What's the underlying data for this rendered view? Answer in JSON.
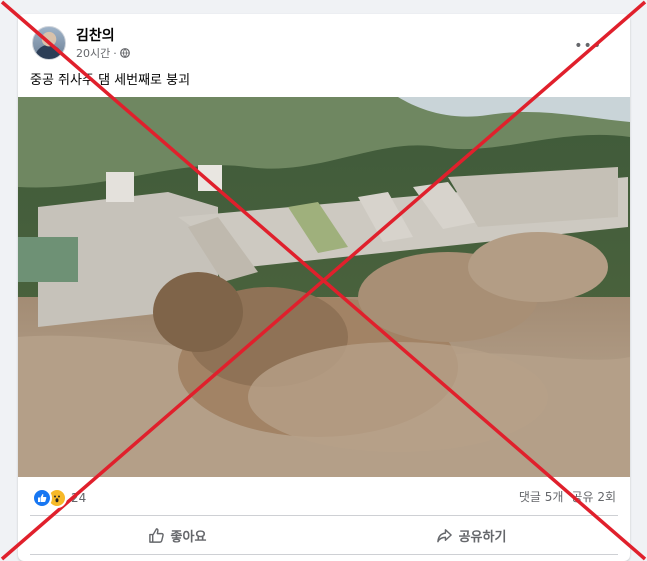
{
  "post": {
    "author": "김찬의",
    "time": "20시간",
    "dot": "·",
    "privacy_icon": "globe-icon",
    "caption": "중공 쥐사주 댐 세번째로 붕괴",
    "photo_icon": "dam-flood-photo"
  },
  "reactions": {
    "icons": [
      "like-icon",
      "wow-icon"
    ],
    "count": "24"
  },
  "counts": {
    "comments": "댓글 5개",
    "shares": "공유 2회"
  },
  "actions": {
    "like_label": "좋아요",
    "share_label": "공유하기"
  },
  "colors": {
    "overlay_x": "#e0202c",
    "facebook_blue": "#1877f2",
    "wow_yellow": "#f7b928"
  }
}
